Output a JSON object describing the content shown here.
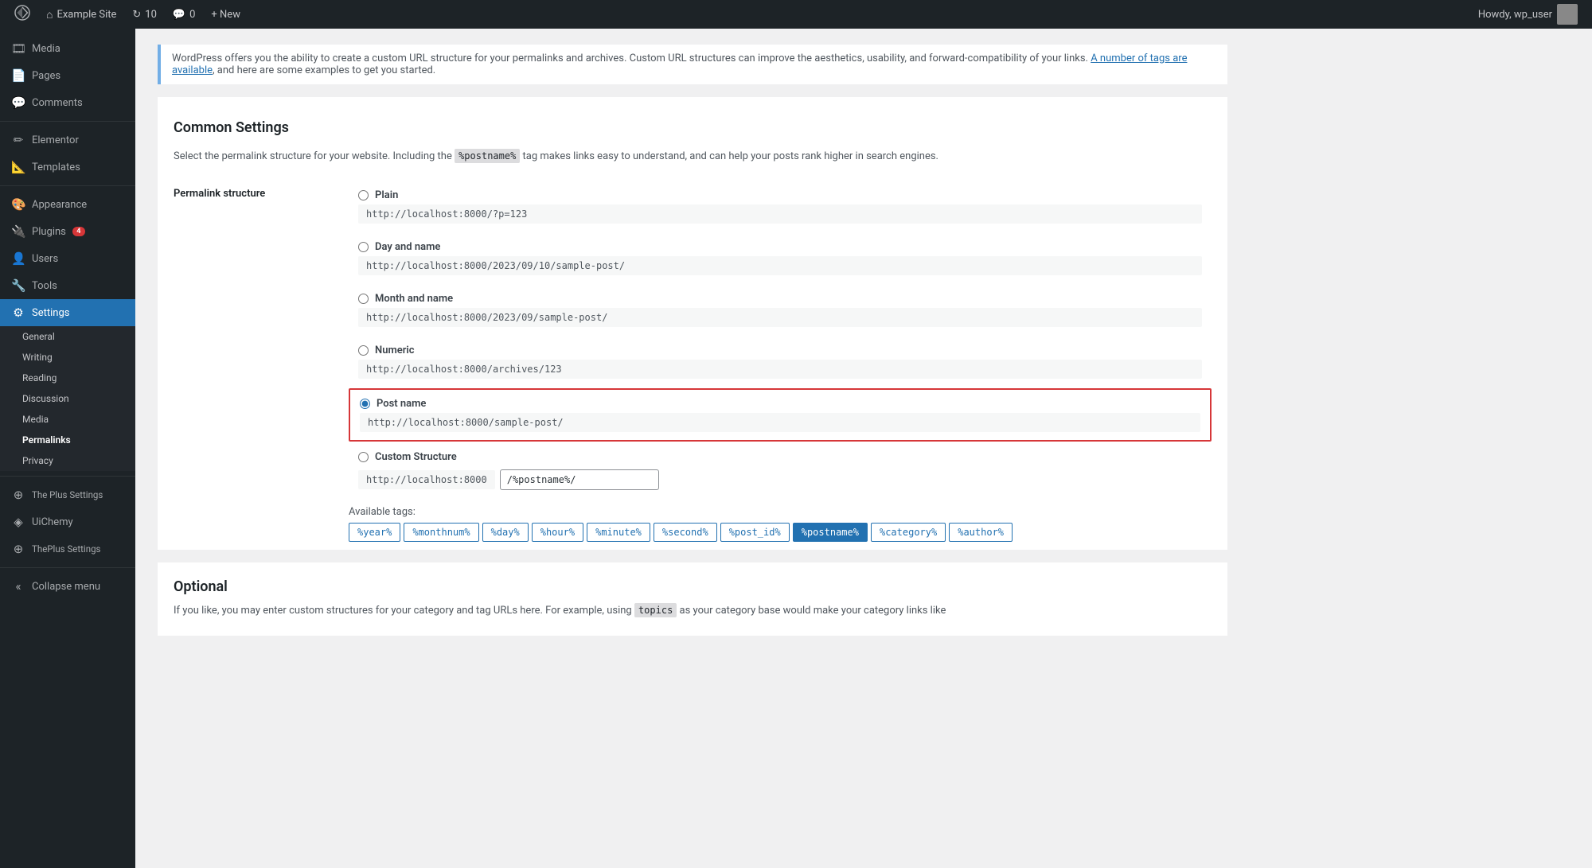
{
  "topbar": {
    "logo_icon": "wordpress-icon",
    "site_name": "Example Site",
    "updates_count": "10",
    "comments_count": "0",
    "new_label": "+ New",
    "howdy_text": "Howdy, wp_user"
  },
  "sidebar": {
    "items": [
      {
        "id": "media",
        "label": "Media",
        "icon": "🎞"
      },
      {
        "id": "pages",
        "label": "Pages",
        "icon": "📄"
      },
      {
        "id": "comments",
        "label": "Comments",
        "icon": "💬"
      },
      {
        "id": "elementor",
        "label": "Elementor",
        "icon": "✏"
      },
      {
        "id": "templates",
        "label": "Templates",
        "icon": "📐"
      },
      {
        "id": "appearance",
        "label": "Appearance",
        "icon": "🎨"
      },
      {
        "id": "plugins",
        "label": "Plugins",
        "icon": "🔌",
        "badge": "4"
      },
      {
        "id": "users",
        "label": "Users",
        "icon": "👤"
      },
      {
        "id": "tools",
        "label": "Tools",
        "icon": "🔧"
      },
      {
        "id": "settings",
        "label": "Settings",
        "icon": "⚙",
        "active": true
      }
    ],
    "settings_submenu": [
      {
        "id": "general",
        "label": "General"
      },
      {
        "id": "writing",
        "label": "Writing"
      },
      {
        "id": "reading",
        "label": "Reading"
      },
      {
        "id": "discussion",
        "label": "Discussion"
      },
      {
        "id": "media",
        "label": "Media"
      },
      {
        "id": "permalinks",
        "label": "Permalinks",
        "active": true
      },
      {
        "id": "privacy",
        "label": "Privacy"
      }
    ],
    "extra_items": [
      {
        "id": "the-plus-settings",
        "label": "The Plus Settings",
        "icon": "⊕"
      },
      {
        "id": "uichemy",
        "label": "UiChemy",
        "icon": "◈"
      },
      {
        "id": "theplus-settings2",
        "label": "ThePlus Settings",
        "icon": "⊕"
      },
      {
        "id": "collapse",
        "label": "Collapse menu",
        "icon": "«"
      }
    ]
  },
  "main": {
    "info_banner": "WordPress offers you the ability to create a custom URL structure for your permalinks and archives. Custom URL structures can improve the aesthetics, usability, and forward-compatibility of your links.",
    "info_link_text": "A number of tags are available",
    "info_link_suffix": ", and here are some examples to get you started.",
    "common_settings_heading": "Common Settings",
    "common_desc_prefix": "Select the permalink structure for your website. Including the ",
    "common_desc_code": "%postname%",
    "common_desc_suffix": " tag makes links easy to understand, and can help your posts rank higher in search engines.",
    "permalink_structure_label": "Permalink structure",
    "options": [
      {
        "id": "plain",
        "label": "Plain",
        "url": "http://localhost:8000/?p=123",
        "selected": false
      },
      {
        "id": "day-and-name",
        "label": "Day and name",
        "url": "http://localhost:8000/2023/09/10/sample-post/",
        "selected": false
      },
      {
        "id": "month-and-name",
        "label": "Month and name",
        "url": "http://localhost:8000/2023/09/sample-post/",
        "selected": false
      },
      {
        "id": "numeric",
        "label": "Numeric",
        "url": "http://localhost:8000/archives/123",
        "selected": false
      },
      {
        "id": "post-name",
        "label": "Post name",
        "url": "http://localhost:8000/sample-post/",
        "selected": true
      },
      {
        "id": "custom-structure",
        "label": "Custom Structure",
        "url_prefix": "http://localhost:8000",
        "url_value": "/%postname%/",
        "selected": false
      }
    ],
    "available_tags_label": "Available tags:",
    "tags": [
      "%year%",
      "%monthnum%",
      "%day%",
      "%hour%",
      "%minute%",
      "%second%",
      "%post_id%",
      "%postname%",
      "%category%",
      "%author%"
    ],
    "active_tag": "%postname%",
    "optional_heading": "Optional",
    "optional_desc": "If you like, you may enter custom structures for your category and tag URLs here. For example, using ",
    "optional_code": "topics",
    "optional_desc2": " as your category base would make your category links like"
  }
}
